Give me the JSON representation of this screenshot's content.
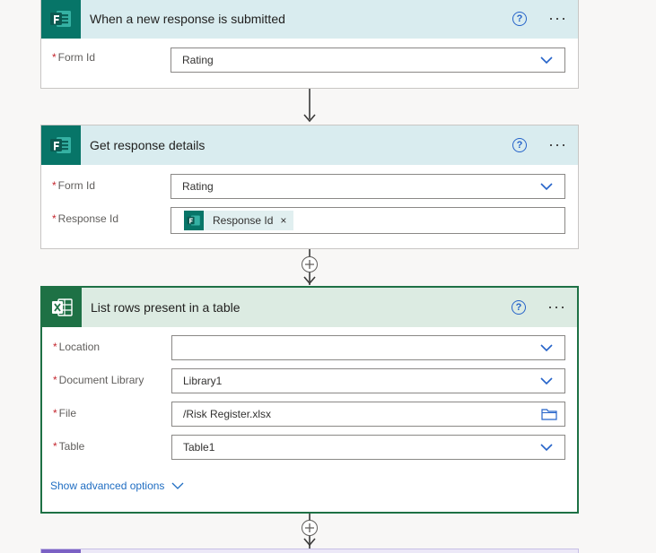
{
  "steps": [
    {
      "title": "When a new response is submitted",
      "help": "?",
      "more": "···",
      "fields": [
        {
          "label": "Form Id",
          "value": "Rating"
        }
      ]
    },
    {
      "title": "Get response details",
      "help": "?",
      "more": "···",
      "fields": [
        {
          "label": "Form Id",
          "value": "Rating"
        },
        {
          "label": "Response Id",
          "token": "Response Id",
          "token_close": "×"
        }
      ]
    },
    {
      "title": "List rows present in a table",
      "help": "?",
      "more": "···",
      "fields": [
        {
          "label": "Location",
          "value": ""
        },
        {
          "label": "Document Library",
          "value": "Library1"
        },
        {
          "label": "File",
          "value": "/Risk Register.xlsx"
        },
        {
          "label": "Table",
          "value": "Table1"
        }
      ],
      "advanced_link": "Show advanced options"
    }
  ],
  "required_mark": "*",
  "icons": {
    "forms": "forms-icon",
    "excel": "excel-icon",
    "chevron": "chevron-down-icon",
    "folder": "folder-icon",
    "help": "help-icon",
    "more": "more-icon",
    "add": "add-step-icon"
  },
  "colors": {
    "forms_header_bg": "#d9ecef",
    "forms_icon_bg": "#077568",
    "excel_header_bg": "#dcebe2",
    "excel_icon_bg": "#1e7145",
    "excel_border": "#1e7145",
    "link": "#1f6dc2",
    "accent": "#2563c9",
    "next_card_accent": "#7b61c4"
  }
}
